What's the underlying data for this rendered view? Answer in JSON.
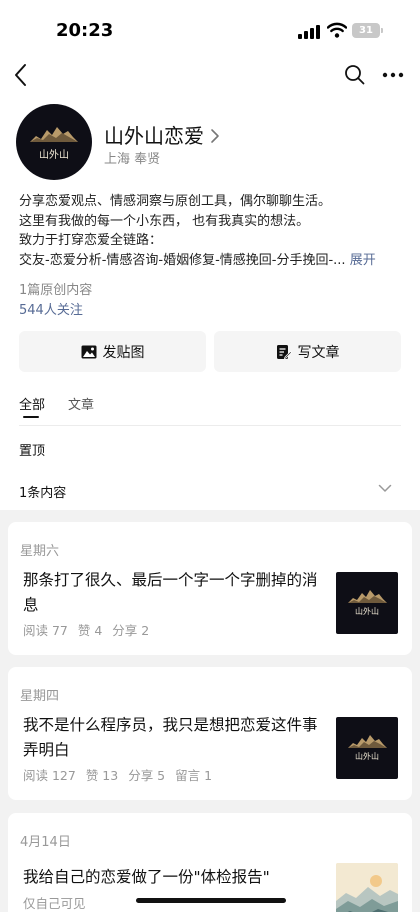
{
  "status_bar": {
    "time": "20:23",
    "battery": "31"
  },
  "profile": {
    "name": "山外山恋爱",
    "location": "上海 奉贤",
    "logo_text": "山外山"
  },
  "bio": {
    "lines": [
      "分享恋爱观点、情感洞察与原创工具，偶尔聊聊生活。",
      "这里有我做的每一个小东西， 也有我真实的想法。",
      "致力于打穿恋爱全链路：",
      "交友-恋爱分析-情感咨询-婚姻修复-情感挽回-分手挽回-..."
    ],
    "expand_label": "展开"
  },
  "stats": {
    "original": "1篇原创内容",
    "followers": "544人关注"
  },
  "actions": {
    "post_label": "发贴图",
    "article_label": "写文章"
  },
  "tabs": {
    "all": "全部",
    "article": "文章"
  },
  "pinned": {
    "title": "置顶",
    "count": "1条内容"
  },
  "posts": [
    {
      "date": "星期六",
      "title": "那条打了很久、最后一个字一个字删掉的消息",
      "read": "阅读 77",
      "likes": "赞 4",
      "shares": "分享 2",
      "thumb_text": "山外山"
    },
    {
      "date": "星期四",
      "title": "我不是什么程序员，我只是想把恋爱这件事弄明白",
      "read": "阅读 127",
      "likes": "赞 13",
      "shares": "分享 5",
      "comments": "留言 1",
      "thumb_text": "山外山"
    },
    {
      "date": "4月14日",
      "title": "我给自己的恋爱做了一份\"体检报告\"",
      "visibility": "仅自己可见"
    }
  ],
  "colors": {
    "link": "#576b95",
    "feed_bg": "#f2f2f2",
    "logo_bg": "#0e0e16"
  },
  "icons": [
    "back-arrow-icon",
    "search-icon",
    "more-icon",
    "chevron-right-icon",
    "image-icon",
    "edit-document-icon",
    "chevron-down-icon"
  ]
}
